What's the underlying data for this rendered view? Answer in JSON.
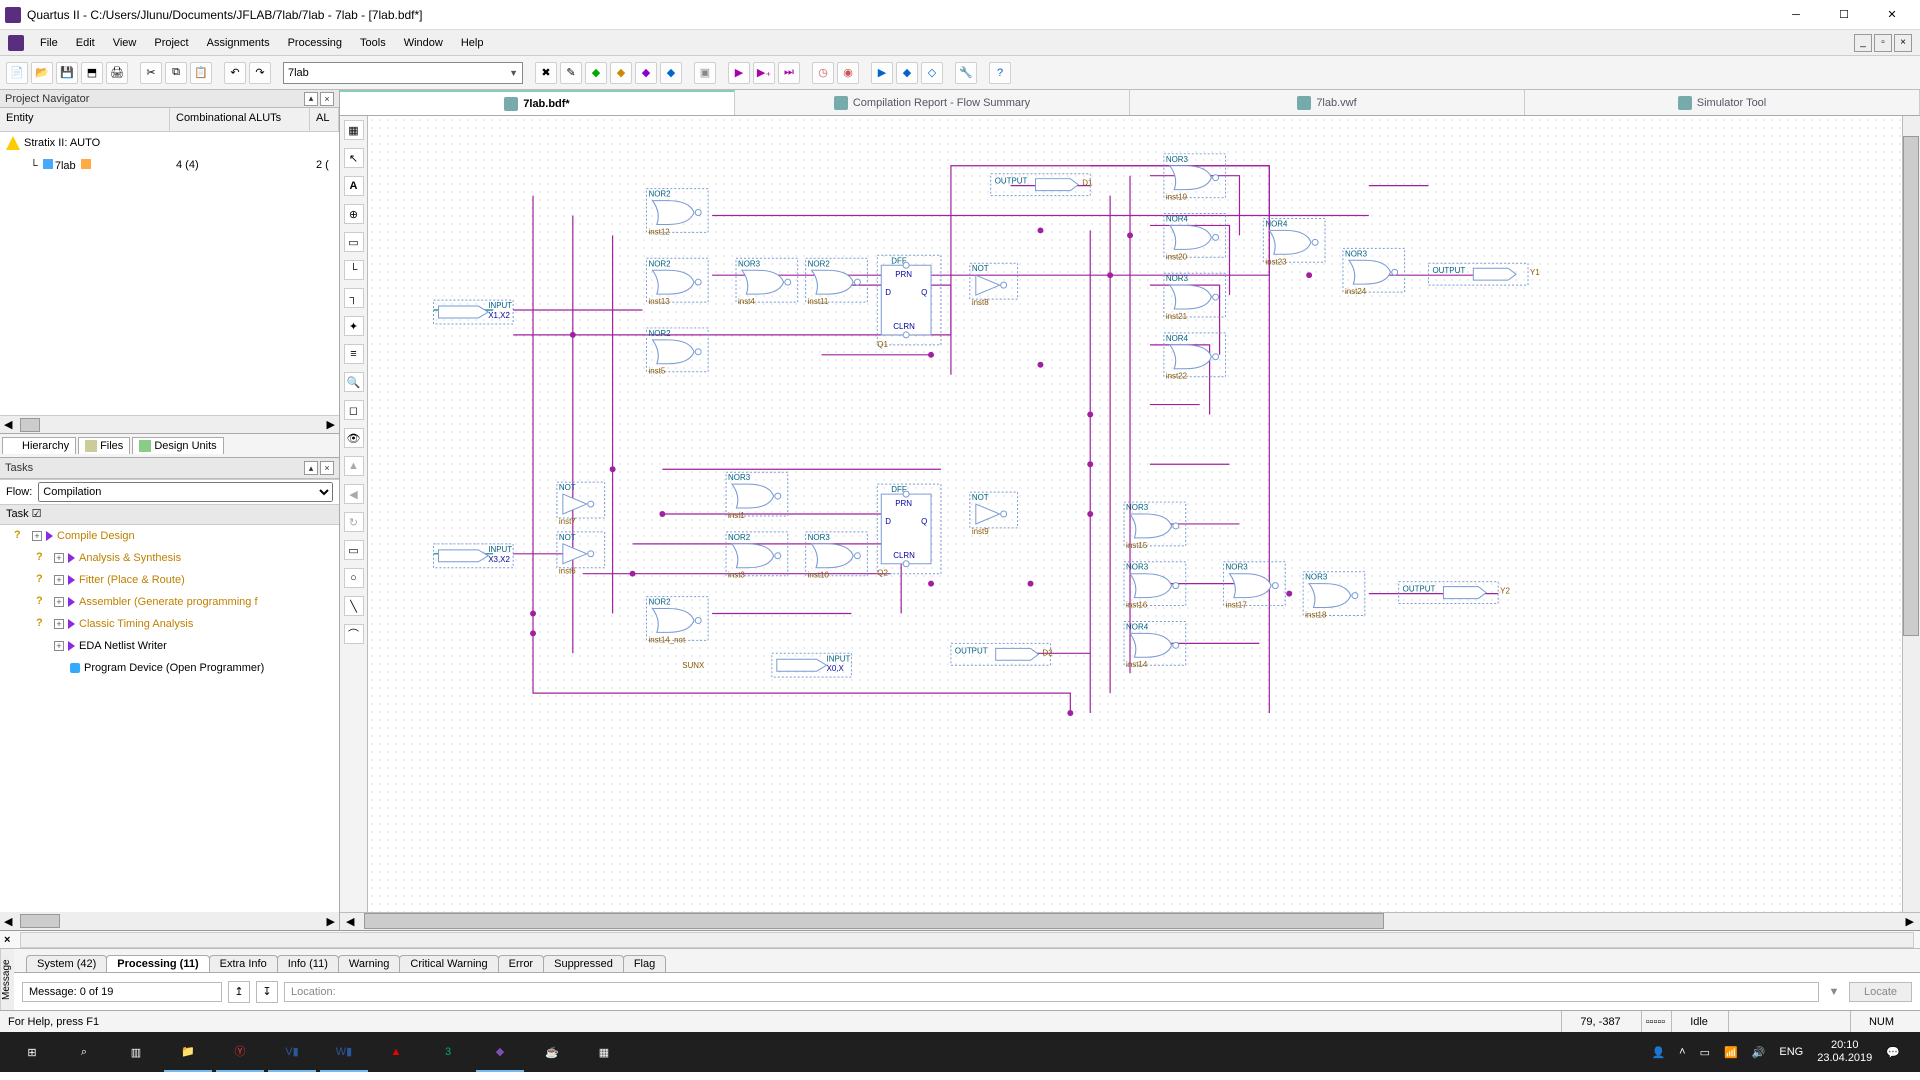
{
  "title": "Quartus II - C:/Users/Jlunu/Documents/JFLAB/7lab/7lab - 7lab - [7lab.bdf*]",
  "menu": {
    "file": "File",
    "edit": "Edit",
    "view": "View",
    "project": "Project",
    "assignments": "Assignments",
    "processing": "Processing",
    "tools": "Tools",
    "window": "Window",
    "help": "Help"
  },
  "toolbar_combo": "7lab",
  "project_navigator": {
    "title": "Project Navigator",
    "cols": {
      "entity": "Entity",
      "aluts": "Combinational ALUTs",
      "al": "AL"
    },
    "rows": [
      {
        "entity": "Stratix II: AUTO",
        "aluts": "",
        "al": ""
      },
      {
        "entity": "7lab",
        "aluts": "4 (4)",
        "al": "2 ("
      }
    ],
    "tabs": {
      "hierarchy": "Hierarchy",
      "files": "Files",
      "design": "Design Units"
    }
  },
  "tasks_panel": {
    "title": "Tasks",
    "flow_label": "Flow:",
    "flow_value": "Compilation",
    "task_hdr": "Task",
    "nodes": [
      {
        "t": "Compile Design",
        "c": "amber",
        "play": true,
        "exp": true,
        "i": 0
      },
      {
        "t": "Analysis & Synthesis",
        "c": "amber",
        "play": true,
        "exp": true,
        "i": 1
      },
      {
        "t": "Fitter (Place & Route)",
        "c": "amber",
        "play": true,
        "exp": true,
        "i": 1
      },
      {
        "t": "Assembler (Generate programming f",
        "c": "amber",
        "play": true,
        "exp": true,
        "i": 1
      },
      {
        "t": "Classic Timing Analysis",
        "c": "amber",
        "play": true,
        "exp": true,
        "i": 1
      },
      {
        "t": "EDA Netlist Writer",
        "c": "black",
        "play": true,
        "exp": true,
        "i": 1
      },
      {
        "t": "Program Device (Open Programmer)",
        "c": "black",
        "play": false,
        "exp": false,
        "i": 1
      }
    ]
  },
  "doc_tabs": [
    {
      "label": "7lab.bdf*",
      "active": true
    },
    {
      "label": "Compilation Report - Flow Summary",
      "active": false
    },
    {
      "label": "7lab.vwf",
      "active": false
    },
    {
      "label": "Simulator Tool",
      "active": false
    }
  ],
  "schematic": {
    "inputs": [
      "INPUT",
      "INPUT",
      "INPUT"
    ],
    "input_lbl": [
      "X1,X2",
      "X3,X2",
      "X0,X"
    ],
    "outputs": [
      "OUTPUT",
      "OUTPUT",
      "OUTPUT",
      "OUTPUT"
    ],
    "output_lbl": [
      "D1",
      "Y1",
      "D2",
      "Y2"
    ],
    "gates": [
      "NOR2",
      "NOR2",
      "NOR2",
      "NOR3",
      "NOR2",
      "NOT",
      "NOT",
      "NOT",
      "NOT",
      "NOR2",
      "NOR3",
      "NOR2",
      "NOR3",
      "DFF",
      "DFF",
      "NOR3",
      "NOR4",
      "NOR3",
      "NOR4",
      "NOR4",
      "NOR3",
      "NOR3",
      "NOR3",
      "NOR3",
      "NOR4",
      "NOR3"
    ],
    "inst": [
      "inst12",
      "inst13",
      "inst5",
      "inst4",
      "inst11",
      "inst7",
      "inst6",
      "inst8",
      "inst9",
      "inst14_not",
      "inst1",
      "inst3",
      "inst10",
      "Q1",
      "Q2",
      "inst19",
      "inst20",
      "inst21",
      "inst22",
      "inst23",
      "inst24",
      "inst15",
      "inst16",
      "inst17",
      "inst14",
      "inst18"
    ],
    "ff": [
      "PRN",
      "D",
      "CLRN",
      "Q"
    ],
    "sunx": "SUNX"
  },
  "msgs": {
    "x": "×",
    "tabs": [
      "System (42)",
      "Processing (11)",
      "Extra Info",
      "Info (11)",
      "Warning",
      "Critical Warning",
      "Error",
      "Suppressed",
      "Flag"
    ],
    "active": 1,
    "count": "Message: 0 of 19",
    "loc_lbl": "Location:",
    "locate": "Locate",
    "side": "Message"
  },
  "status": {
    "help": "For Help, press F1",
    "coord": "79, -387",
    "idle": "Idle",
    "num": "NUM"
  },
  "taskbar": {
    "lang": "ENG",
    "time": "20:10",
    "date": "23.04.2019"
  }
}
